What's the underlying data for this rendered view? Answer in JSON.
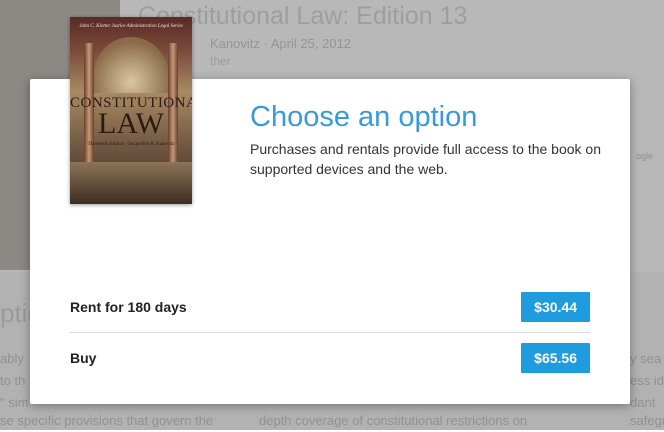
{
  "background": {
    "book_title": "Constitutional Law: Edition 13",
    "author_date": "Kanovitz · April 25, 2012",
    "publisher": "ther",
    "section_heading": "ptio",
    "col1_lines": [
      "ably",
      "to th",
      "\" sim",
      "se specific provisions that govern the"
    ],
    "col2_lines": [
      "depth coverage of constitutional restrictions on"
    ],
    "col3_lines": [
      "y sea",
      "ess ide",
      "dant",
      "safeguard"
    ],
    "side_text": "ogle"
  },
  "dialog": {
    "title": "Choose an option",
    "description": "Purchases and rentals provide full access to the book on supported devices and the web.",
    "cover": {
      "series_text": "John C. Klotter Justice Administration Legal Series",
      "title_line1": "CONSTITUTIONAL",
      "title_line2": "LAW",
      "edition_line": "Thirteenth Edition  |  Jacqueline R. Kanovitz"
    },
    "options": [
      {
        "label": "Rent for 180 days",
        "price": "$30.44"
      },
      {
        "label": "Buy",
        "price": "$65.56"
      }
    ]
  },
  "colors": {
    "accent": "#1f9cdd",
    "title": "#3a9ad9"
  }
}
